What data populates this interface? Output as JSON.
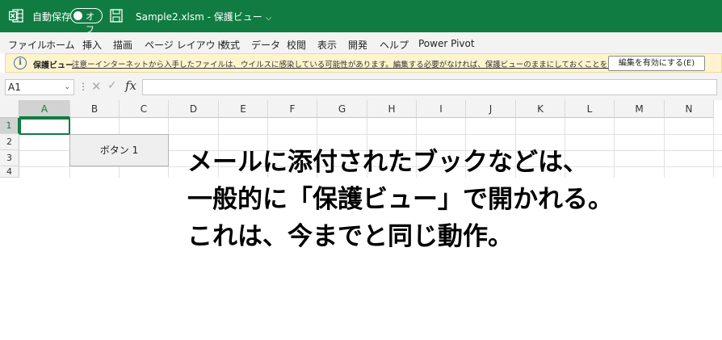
{
  "titlebar": {
    "autosave_label": "自動保存",
    "toggle_text": "オフ",
    "doc_title": "Sample2.xlsm  -  保護ビュー",
    "chevron": "⌵",
    "bg_color": "#107c41",
    "icons": [
      "excel-icon",
      "save-icon",
      "chevron-down-icon"
    ]
  },
  "menu": [
    "ファイル",
    "ホーム",
    "挿入",
    "描画",
    "ページ レイアウト",
    "数式",
    "データ",
    "校閲",
    "表示",
    "開発",
    "ヘルプ",
    "Power Pivot"
  ],
  "protected_view": {
    "title": "保護ビュー",
    "message": "注意ーインターネットから入手したファイルは、ウイルスに感染している可能性があります。編集する必要がなければ、保護ビューのままにしておくことをお勧めします。",
    "enable_button": "編集を有効にする(E)",
    "icon": "i",
    "bg_color": "#fff4ce"
  },
  "formula_bar": {
    "name_box": "A1",
    "dropdown": "⌄",
    "dots": "⋮",
    "cancel": "✕",
    "enter": "✓",
    "fx": "fx",
    "formula": ""
  },
  "grid": {
    "columns": [
      "A",
      "B",
      "C",
      "D",
      "E",
      "F",
      "G",
      "H",
      "I",
      "J",
      "K",
      "L",
      "M",
      "N"
    ],
    "rows": [
      "1",
      "2",
      "3",
      "4"
    ],
    "selected_column": "A",
    "selected_row": "1",
    "button_label": "ボタン 1"
  },
  "overlay": {
    "lines": [
      "メールに添付されたブックなどは、",
      "一般的に「保護ビュー」で開かれる。",
      "これは、今までと同じ動作。"
    ]
  }
}
